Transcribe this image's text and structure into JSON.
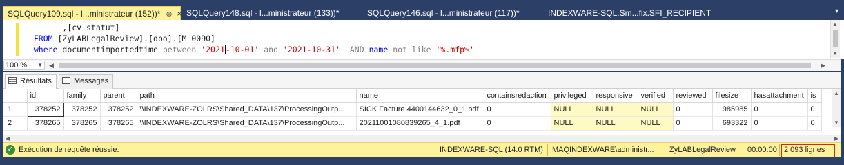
{
  "tabs": [
    {
      "label": "SQLQuery109.sql - l...ministrateur (152))*",
      "active": true
    },
    {
      "label": "SQLQuery148.sql - l...ministrateur (133))*",
      "active": false
    },
    {
      "label": "SQLQuery146.sql - l...ministrateur (117))*",
      "active": false
    },
    {
      "label": "INDEXWARE-SQL.Sm...fix.SFI_RECIPIENT",
      "active": false
    }
  ],
  "tab_pin": "⊕",
  "tab_close": "×",
  "tab_overflow": "▾",
  "editor": {
    "line1": ",[cv_statut]",
    "line2_kw": "FROM",
    "line2_rest": " [ZyLABLegalReview].[dbo].[M_0090]",
    "line3_kw": "where",
    "line3_col": " documentimportedtime ",
    "line3_between": "between",
    "line3_str1a": " '2021",
    "line3_str1b": "-10-01'",
    "line3_and": " and ",
    "line3_str2": "'2021-10-31'",
    "line3_AND": "  AND",
    "line3_name": " name",
    "line3_notlike": " not like",
    "line3_str3": " '%.mfp%'"
  },
  "zoom": {
    "value": "100 %"
  },
  "results_tabs": [
    {
      "label": "Résultats",
      "icon": "grid-icon",
      "active": true
    },
    {
      "label": "Messages",
      "icon": "messages-icon",
      "active": false
    }
  ],
  "grid": {
    "columns": [
      "",
      "id",
      "family",
      "parent",
      "path",
      "name",
      "containsredaction",
      "privileged",
      "responsive",
      "verified",
      "reviewed",
      "filesize",
      "hasattachment",
      "is"
    ],
    "rows": [
      [
        "1",
        "378252",
        "378252",
        "378252",
        "\\\\INDEXWARE-ZOLRS\\Shared_DATA\\137\\ProcessingOutp...",
        "SICK Facture 4400144632_0_1.pdf",
        "0",
        "NULL",
        "NULL",
        "NULL",
        "0",
        "985985",
        "0",
        "0"
      ],
      [
        "2",
        "378265",
        "378265",
        "378265",
        "\\\\INDEXWARE-ZOLRS\\Shared_DATA\\137\\ProcessingOutp...",
        "20211001080839265_4_1.pdf",
        "0",
        "NULL",
        "NULL",
        "NULL",
        "0",
        "693322",
        "0",
        "0"
      ]
    ]
  },
  "status": {
    "message": "Exécution de requête réussie.",
    "server": "INDEXWARE-SQL (14.0 RTM)",
    "user": "MAQINDEXWARE\\administr...",
    "database": "ZyLABLegalReview",
    "elapsed": "00:00:00",
    "rows": "2 093 lignes",
    "colors": {
      "bar": "#fff29d",
      "highlight": "#d9261c"
    }
  }
}
